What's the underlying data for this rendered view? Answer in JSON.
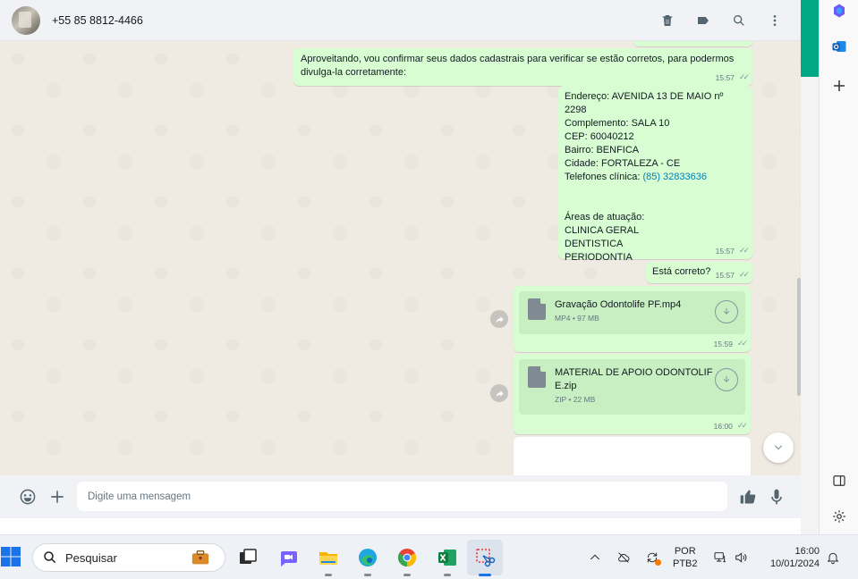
{
  "header": {
    "contact": "+55 85 8812-4466"
  },
  "messages": [
    {
      "text_lines": [
        "Aproveitando, vou confirmar seus dados cadastrais para verificar se estão corretos, para podermos",
        "divulga-la corretamente:"
      ],
      "time": "15:57"
    },
    {
      "lines": [
        "Endereço: AVENIDA 13 DE MAIO nº 2298",
        "Complemento: SALA 10",
        "CEP: 60040212",
        "Bairro: BENFICA",
        "Cidade: FORTALEZA - CE"
      ],
      "phone_label": "Telefones clínica: ",
      "phone_link": "(85) 32833636",
      "areas_title": "Áreas de atuação:",
      "areas": [
        "CLINICA GERAL",
        "DENTISTICA",
        "PERIODONTIA"
      ],
      "time": "15:57"
    },
    {
      "text": "Está correto?",
      "time": "15:57"
    },
    {
      "file_name": "Gravação Odontolife PF.mp4",
      "file_meta": "MP4 • 97 MB",
      "time": "15:59"
    },
    {
      "file_name_lines": [
        "MATERIAL DE APOIO ODONTOLIF",
        "E.zip"
      ],
      "file_meta": "ZIP • 22 MB",
      "time": "16:00"
    }
  ],
  "composer": {
    "placeholder": "Digite uma mensagem"
  },
  "taskbar": {
    "search_label": "Pesquisar",
    "lang_line1": "POR",
    "lang_line2": "PTB2",
    "time": "16:00",
    "date": "10/01/2024"
  }
}
